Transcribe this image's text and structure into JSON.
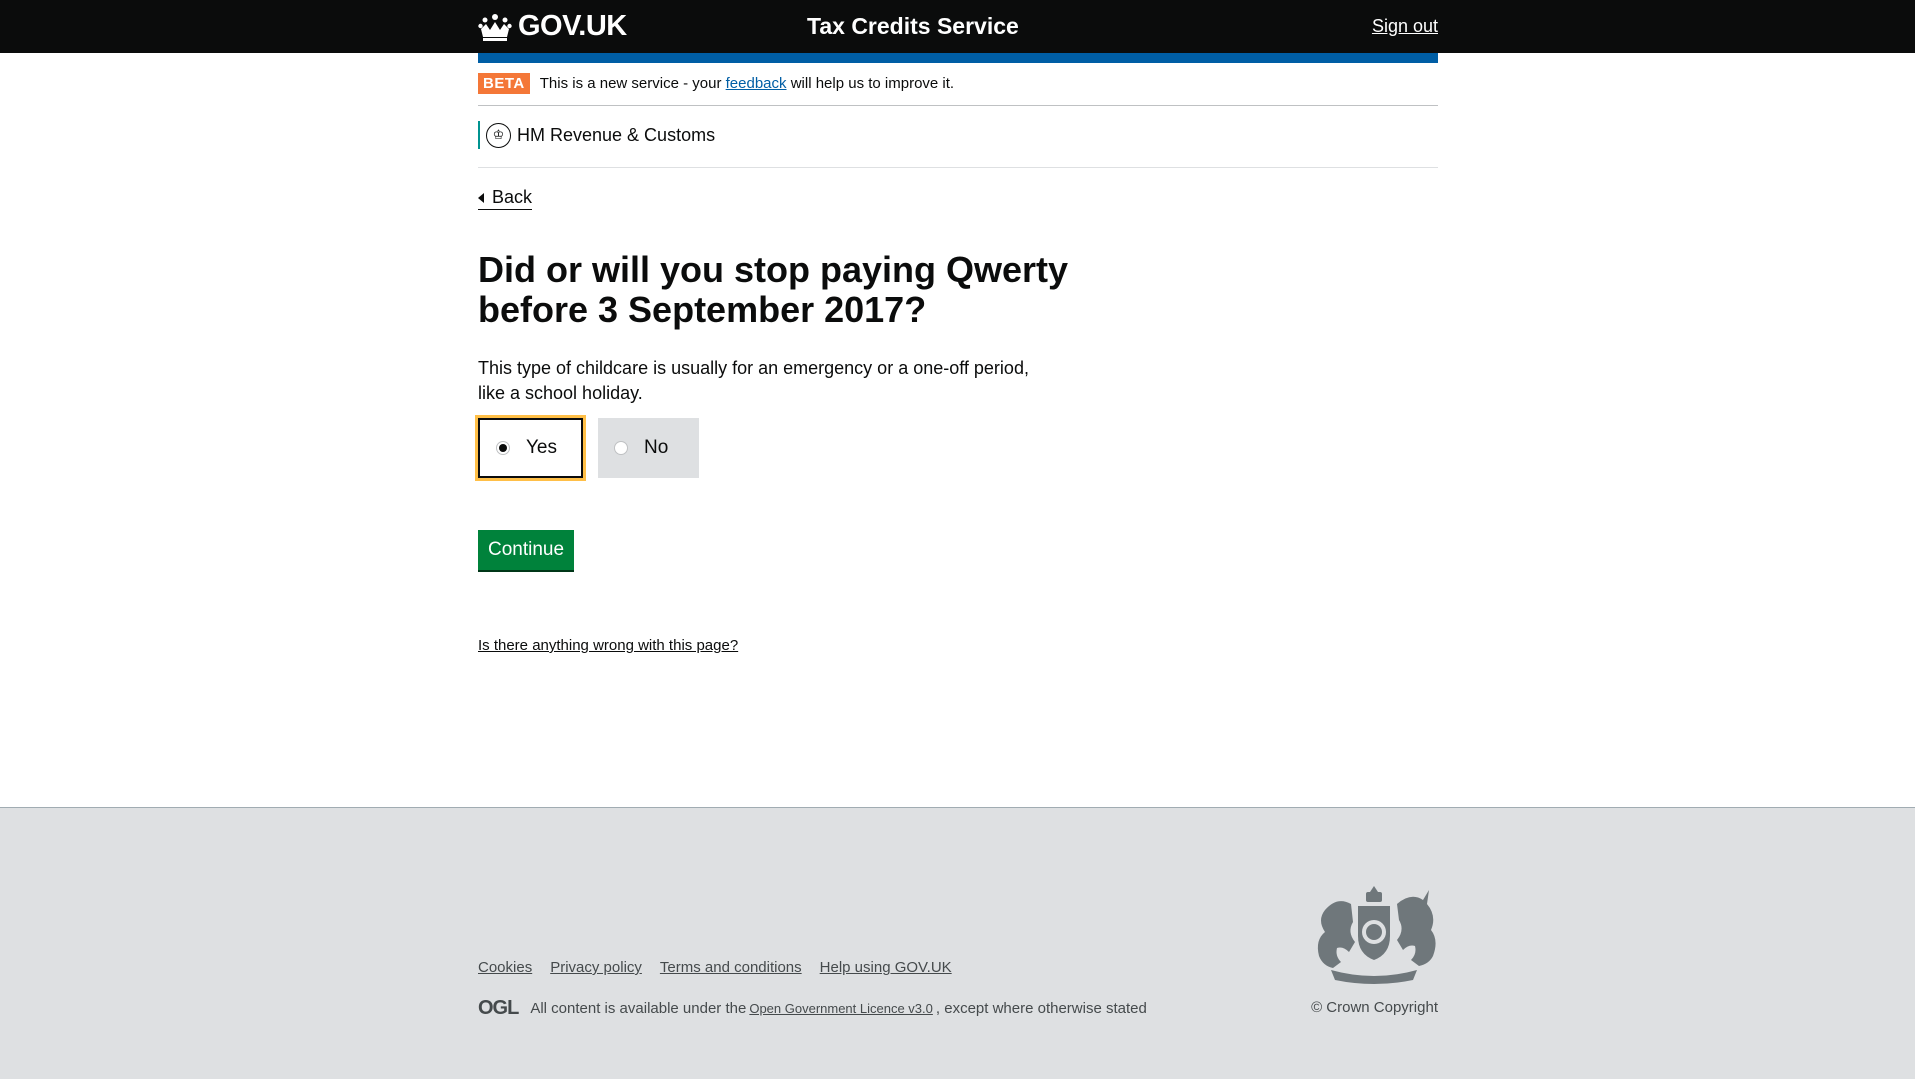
{
  "header": {
    "logo_text": "GOV.UK",
    "service_name": "Tax Credits Service",
    "signout_label": "Sign out"
  },
  "beta_banner": {
    "tag": "BETA",
    "text_before": "This is a new service - your",
    "link": "feedback",
    "text_after": "will help us to improve it."
  },
  "organisation": {
    "name": "HM Revenue & Customs"
  },
  "back_link": "Back",
  "question": {
    "heading": "Did or will you stop paying Qwerty before 3 September 2017?",
    "hint": "This type of childcare is usually for an emergency or a one-off period, like a school holiday.",
    "options": [
      {
        "label": "Yes",
        "selected": true
      },
      {
        "label": "No",
        "selected": false
      }
    ]
  },
  "continue_label": "Continue",
  "report_link": "Is there anything wrong with this page?",
  "footer": {
    "links": [
      "Cookies",
      "Privacy policy",
      "Terms and conditions",
      "Help using GOV.UK"
    ],
    "ogl_logo": "OGL",
    "licence_before": "All content is available under the",
    "licence_link": "Open Government Licence v3.0",
    "licence_after": ", except where otherwise stated",
    "copyright": "© Crown Copyright"
  },
  "colors": {
    "header_bg": "#0b0c0c",
    "blue_bar": "#005ea5",
    "beta_tag": "#f47738",
    "continue_button": "#00823b",
    "focus": "#ffbf47",
    "footer_bg": "#dee0e2"
  }
}
